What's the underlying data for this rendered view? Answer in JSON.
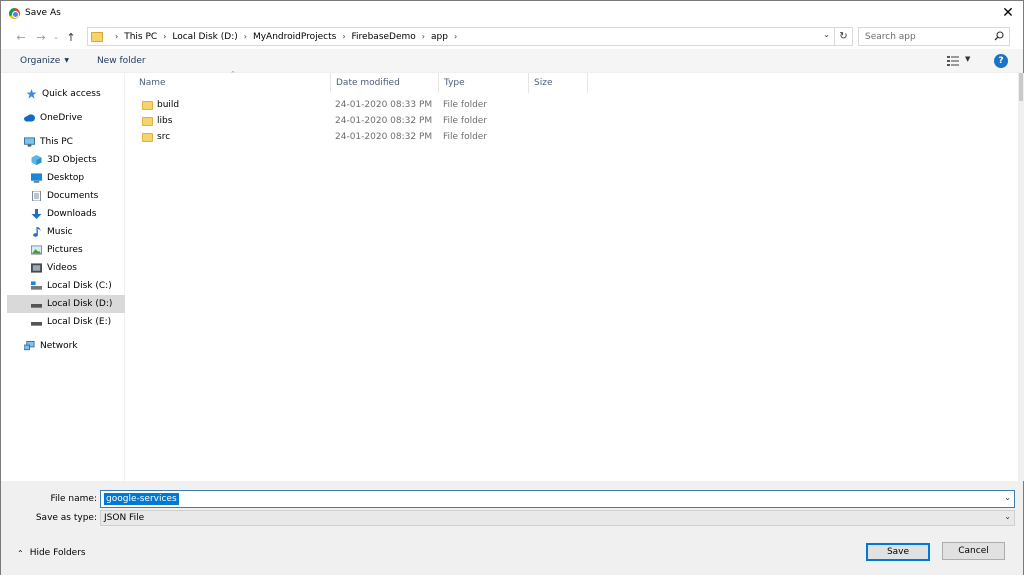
{
  "window": {
    "title": "Save As",
    "close_glyph": "✕"
  },
  "address": {
    "breadcrumbs": [
      "This PC",
      "Local Disk (D:)",
      "MyAndroidProjects",
      "FirebaseDemo",
      "app"
    ],
    "search_placeholder": "Search app"
  },
  "toolbar": {
    "organize_label": "Organize",
    "new_folder_label": "New folder",
    "help_glyph": "?"
  },
  "nav": {
    "items": [
      {
        "label": "Quick access",
        "icon": "star-icon"
      },
      {
        "label": "OneDrive",
        "icon": "cloud-icon"
      },
      {
        "label": "This PC",
        "icon": "computer-icon"
      },
      {
        "label": "3D Objects",
        "icon": "cube-icon"
      },
      {
        "label": "Desktop",
        "icon": "desktop-icon"
      },
      {
        "label": "Documents",
        "icon": "document-icon"
      },
      {
        "label": "Downloads",
        "icon": "download-icon"
      },
      {
        "label": "Music",
        "icon": "music-icon"
      },
      {
        "label": "Pictures",
        "icon": "picture-icon"
      },
      {
        "label": "Videos",
        "icon": "video-icon"
      },
      {
        "label": "Local Disk (C:)",
        "icon": "drive-icon"
      },
      {
        "label": "Local Disk (D:)",
        "icon": "drive-icon"
      },
      {
        "label": "Local Disk (E:)",
        "icon": "drive-icon"
      },
      {
        "label": "Network",
        "icon": "network-icon"
      }
    ]
  },
  "files": {
    "columns": [
      "Name",
      "Date modified",
      "Type",
      "Size"
    ],
    "rows": [
      {
        "name": "build",
        "date": "24-01-2020 08:33 PM",
        "type": "File folder"
      },
      {
        "name": "libs",
        "date": "24-01-2020 08:32 PM",
        "type": "File folder"
      },
      {
        "name": "src",
        "date": "24-01-2020 08:32 PM",
        "type": "File folder"
      }
    ]
  },
  "footer": {
    "file_name_label": "File name:",
    "file_name_value": "google-services",
    "save_type_label": "Save as type:",
    "save_type_value": "JSON File",
    "hide_folders_label": "Hide Folders",
    "save_label": "Save",
    "cancel_label": "Cancel"
  },
  "colors": {
    "accent": "#0078d7",
    "folder": "#f7d46b",
    "selected_nav": "#d9d9d9"
  }
}
